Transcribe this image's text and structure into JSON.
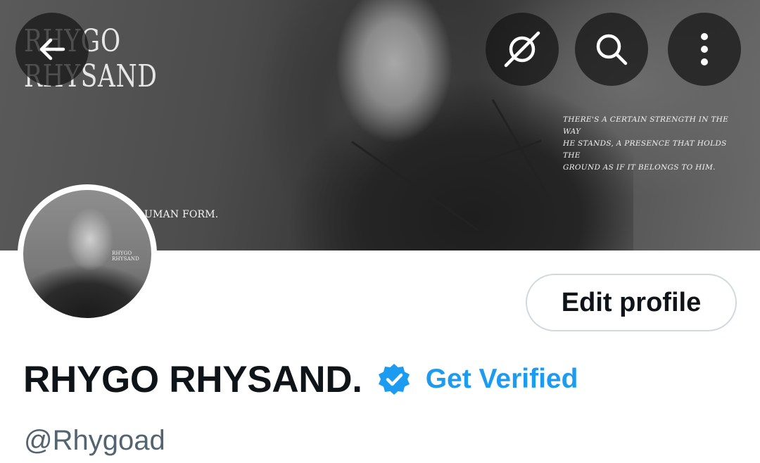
{
  "banner": {
    "title_line1": "RHYGO",
    "title_line2": "RHYSAND",
    "quote_line1": "THERE'S A CERTAIN STRENGTH IN THE WAY",
    "quote_line2": "HE STANDS, A PRESENCE THAT HOLDS THE",
    "quote_line3": "GROUND AS IF IT BELONGS TO HIM.",
    "caption": "UMAN FORM."
  },
  "header_buttons": {
    "back_icon": "arrow-left-icon",
    "grok_icon": "grok-icon",
    "search_icon": "search-icon",
    "more_icon": "more-vertical-icon"
  },
  "avatar": {
    "text_line1": "RHYGO",
    "text_line2": "RHYSAND"
  },
  "profile": {
    "edit_label": "Edit profile",
    "display_name": "RHYGO RHYSAND.",
    "badge_icon": "verified-badge-icon",
    "get_verified_label": "Get Verified",
    "handle": "@Rhygoad"
  },
  "colors": {
    "accent": "#1d9bf0",
    "text_primary": "#0f1419",
    "text_secondary": "#536471",
    "border": "#cfd9de"
  }
}
